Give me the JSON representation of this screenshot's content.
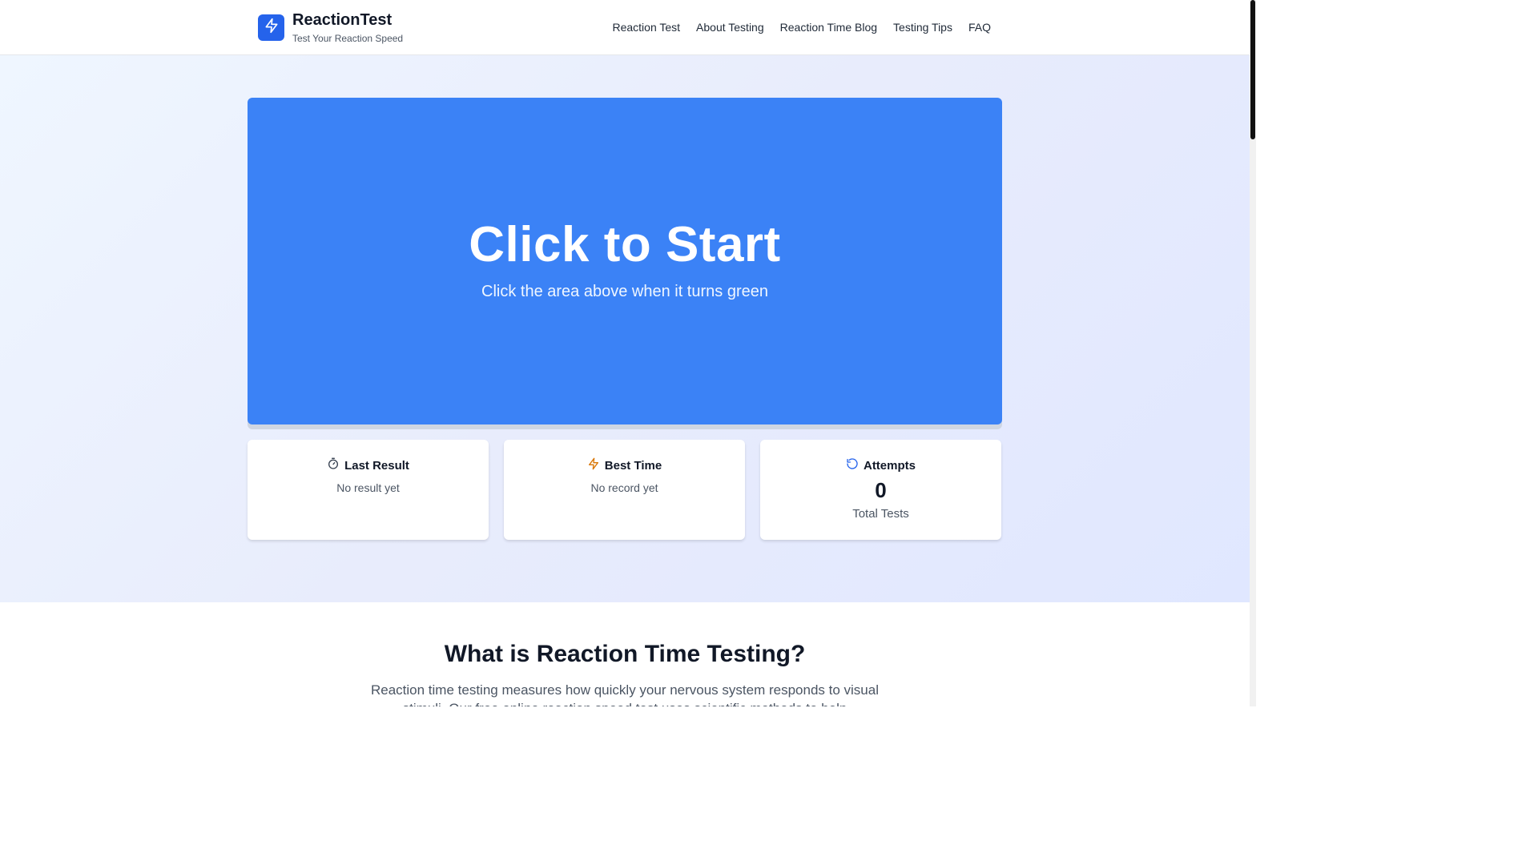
{
  "header": {
    "brand": {
      "title": "ReactionTest",
      "subtitle": "Test Your Reaction Speed",
      "icon": "lightning-icon"
    },
    "nav": [
      {
        "label": "Reaction Test"
      },
      {
        "label": "About Testing"
      },
      {
        "label": "Reaction Time Blog"
      },
      {
        "label": "Testing Tips"
      },
      {
        "label": "FAQ"
      }
    ]
  },
  "test_area": {
    "title": "Click to Start",
    "subtitle": "Click the area above when it turns green",
    "color": "#3b82f6"
  },
  "stats": {
    "last_result": {
      "title": "Last Result",
      "value": "No result yet",
      "icon": "stopwatch-icon"
    },
    "best_time": {
      "title": "Best Time",
      "value": "No record yet",
      "icon": "lightning-icon",
      "icon_color": "#d97706"
    },
    "attempts": {
      "title": "Attempts",
      "count": "0",
      "caption": "Total Tests",
      "icon": "refresh-icon",
      "icon_color": "#2563eb"
    }
  },
  "info": {
    "title": "What is Reaction Time Testing?",
    "text": "Reaction time testing measures how quickly your nervous system responds to visual stimuli. Our free online reaction speed test uses scientific methods to help"
  }
}
